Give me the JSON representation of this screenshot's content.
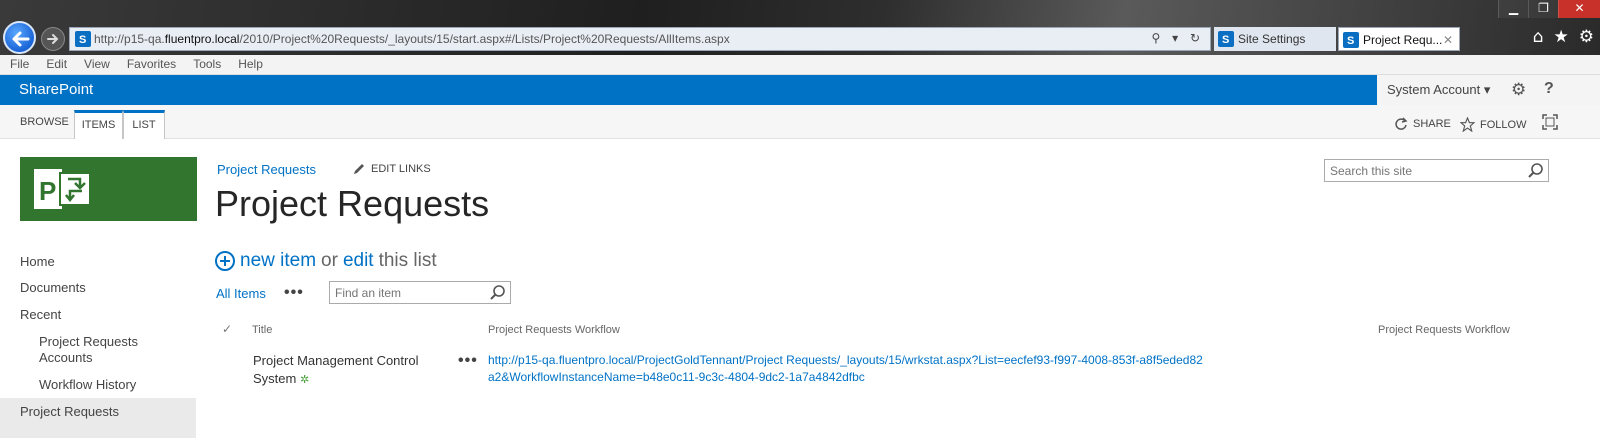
{
  "browser": {
    "url_prefix": "http://p15-qa.",
    "url_domain": "fluentpro.local",
    "url_suffix": "/2010/Project%20Requests/_layouts/15/start.aspx#/Lists/Project%20Requests/AllItems.aspx",
    "tabs": [
      {
        "label": "Site Settings"
      },
      {
        "label": "Project Requ...",
        "close": "✕"
      }
    ],
    "menu": [
      "File",
      "Edit",
      "View",
      "Favorites",
      "Tools",
      "Help"
    ],
    "addr_icons": "⚲ ▾ ↻",
    "window_buttons": {
      "minimize": "▁",
      "restore": "❐",
      "close": "✕"
    },
    "tool_icons": {
      "home": "⌂",
      "favorites": "★",
      "settings": "⚙"
    }
  },
  "suite": {
    "brand": "SharePoint",
    "account": "System Account ▾",
    "settings_icon": "⚙",
    "help": "?"
  },
  "ribbon": {
    "tabs": [
      "BROWSE",
      "ITEMS",
      "LIST"
    ],
    "share": "SHARE",
    "follow": "FOLLOW"
  },
  "site": {
    "breadcrumb": "Project Requests",
    "edit_links": "EDIT LINKS",
    "title": "Project Requests",
    "search_placeholder": "Search this site"
  },
  "left_nav": {
    "items": [
      {
        "label": "Home"
      },
      {
        "label": "Documents"
      },
      {
        "label": "Recent"
      },
      {
        "label": "Project Requests"
      },
      {
        "label": "Accounts"
      },
      {
        "label": "Workflow History"
      },
      {
        "label": "Project Requests"
      }
    ]
  },
  "list": {
    "new_item": "new item",
    "or": "or",
    "edit": "edit",
    "this_list": "this list",
    "view": "All Items",
    "more": "•••",
    "find_placeholder": "Find an item",
    "columns": {
      "check": "✓",
      "title": "Title",
      "workflow1": "Project Requests Workflow",
      "workflow2": "Project Requests Workflow"
    },
    "rows": [
      {
        "title": "Project Management Control System",
        "new_marker": "✲",
        "workflow_url": "http://p15-qa.fluentpro.local/ProjectGoldTennant/Project Requests/_layouts/15/wrkstat.aspx?List=eecfef93-f997-4008-853f-a8f5eded82a2&WorkflowInstanceName=b48e0c11-9c3c-4804-9dc2-1a7a4842dfbc"
      }
    ]
  },
  "colors": {
    "suite_blue": "#0072c6",
    "logo_green": "#31752f",
    "link_blue": "#0072c6"
  }
}
